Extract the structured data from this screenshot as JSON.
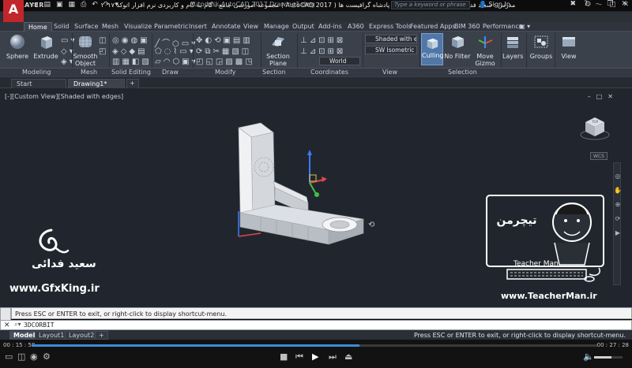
{
  "player": {
    "logo": "KMPLAYER",
    "title": "مجموعه آموزشی جامع ، گام به گام و کاربردی نرم افزار  اتوکد ۲۰۱۷ ( AutoCAD 2017 )   مدرس : سعید فدایی ( تیچرمن ) گروه آموزشی پادشاه گرافیست ها",
    "time_current": "00 : 15 : 58",
    "time_total": "00 : 27 : 28",
    "progress": 0.58,
    "volume": 0.6
  },
  "acad": {
    "logo": "A",
    "title": "Autodesk AutoCAD 2017    Drawing1.dwg",
    "search_placeholder": "Type a keyword or phrase",
    "sign_in": "Sign In"
  },
  "ribbon_tabs": [
    "Home",
    "Solid",
    "Surface",
    "Mesh",
    "Visualize",
    "Parametric",
    "Insert",
    "Annotate",
    "View",
    "Manage",
    "Output",
    "Add-ins",
    "A360",
    "Express Tools",
    "Featured Apps",
    "BIM 360",
    "Performance"
  ],
  "ribbon": {
    "sphere": "Sphere",
    "extrude": "Extrude",
    "smooth_object": "Smooth Object",
    "section_plane": "Section Plane",
    "visual_style": "Shaded with e...",
    "view": "SW Isometric",
    "ucs": "World",
    "culling": "Culling",
    "no_filter": "No Filter",
    "move_gizmo": "Move Gizmo",
    "layers": "Layers",
    "groups": "Groups",
    "view_btn": "View",
    "panels": {
      "modeling": "Modeling",
      "mesh": "Mesh",
      "solid_editing": "Solid Editing",
      "draw": "Draw",
      "modify": "Modify",
      "section": "Section",
      "coordinates": "Coordinates",
      "view": "View",
      "selection": "Selection"
    }
  },
  "file_tabs": {
    "start": "Start",
    "drawing": "Drawing1*"
  },
  "viewport": {
    "label": "[-][Custom View][Shaded with edges]",
    "wcs": "WCS"
  },
  "watermark": {
    "name": "سعید فدائی",
    "site": "www.GfxKing.ir",
    "teacher_brand": "Teacher Man",
    "teacher_site": "www.TeacherMan.ir"
  },
  "command": {
    "history": "Press ESC or ENTER to exit, or right-click to display shortcut-menu.",
    "prompt": "3DCORBIT"
  },
  "layout_tabs": [
    "Model",
    "Layout1",
    "Layout2"
  ],
  "status_message": "Press ESC or ENTER to exit, or right-click to display shortcut-menu."
}
